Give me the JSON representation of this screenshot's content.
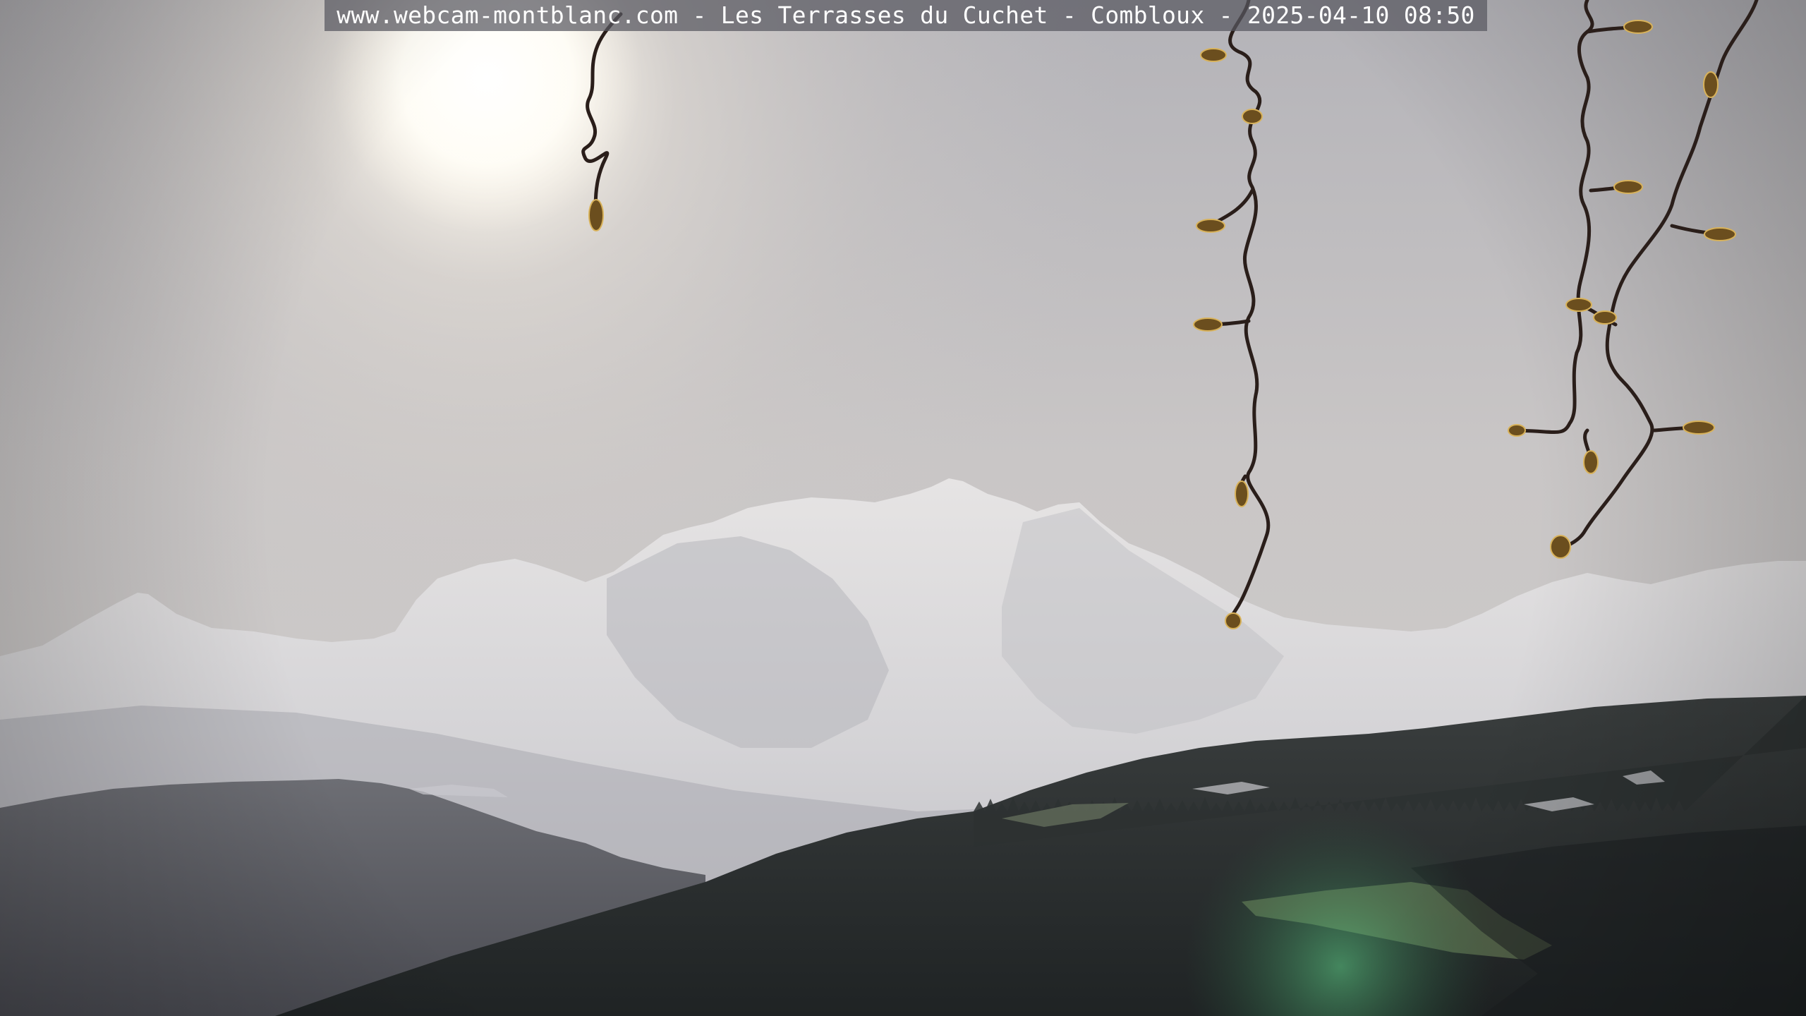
{
  "overlay": {
    "caption": "www.webcam-montblanc.com - Les Terrasses du Cuchet - Combloux - 2025-04-10 08:50"
  }
}
